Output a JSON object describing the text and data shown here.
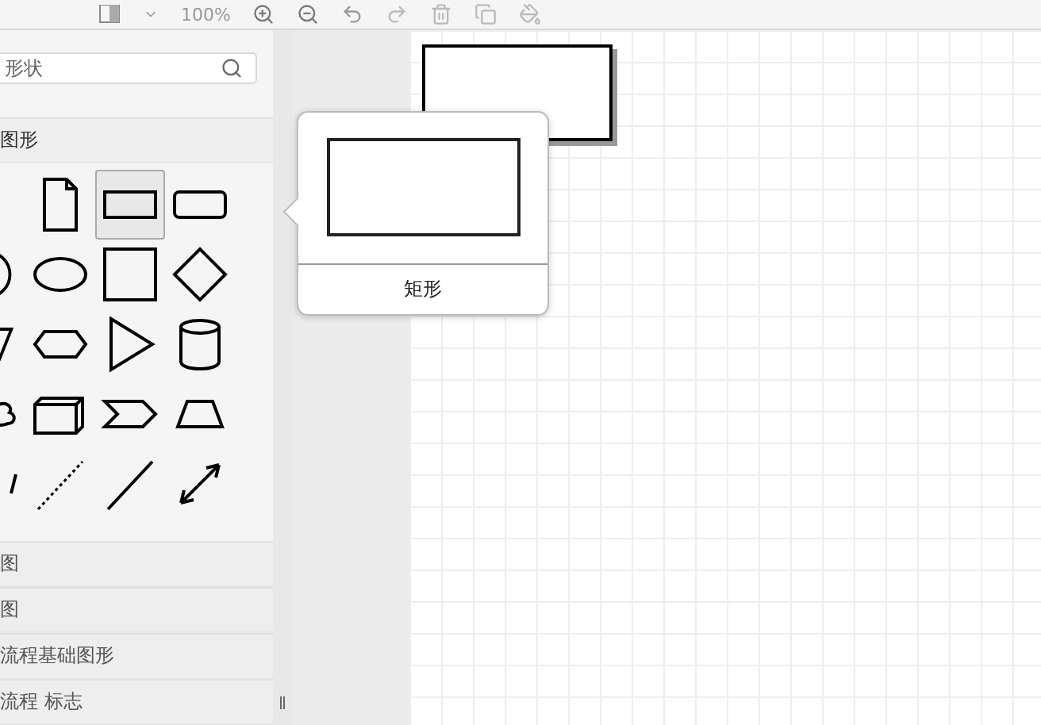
{
  "toolbar": {
    "zoom": "100%"
  },
  "sidebar": {
    "search": {
      "placeholder": "形状"
    },
    "sections": [
      {
        "title": "图形",
        "expanded": true,
        "shapes": [
          {
            "kind": "note",
            "selected": false
          },
          {
            "kind": "rectangle",
            "selected": true
          },
          {
            "kind": "rounded",
            "selected": false
          },
          {
            "kind": "circle",
            "selected": false
          },
          {
            "kind": "ellipse",
            "selected": false
          },
          {
            "kind": "square",
            "selected": false
          },
          {
            "kind": "diamond",
            "selected": false
          },
          {
            "kind": "parallelogram",
            "selected": false
          },
          {
            "kind": "hexagon",
            "selected": false
          },
          {
            "kind": "triangle",
            "selected": false
          },
          {
            "kind": "cylinder",
            "selected": false
          },
          {
            "kind": "cloud",
            "selected": false
          },
          {
            "kind": "cube",
            "selected": false
          },
          {
            "kind": "step",
            "selected": false
          },
          {
            "kind": "trapezoid",
            "selected": false
          },
          {
            "kind": "curve",
            "selected": false
          },
          {
            "kind": "dotted",
            "selected": false
          },
          {
            "kind": "line",
            "selected": false
          },
          {
            "kind": "arrow",
            "selected": false
          }
        ]
      },
      {
        "title": "图",
        "expanded": false
      },
      {
        "title": "图",
        "expanded": false
      },
      {
        "title": "流程基础图形",
        "expanded": false
      },
      {
        "title": "流程 标志",
        "expanded": false
      }
    ]
  },
  "tooltip": {
    "label": "矩形"
  }
}
